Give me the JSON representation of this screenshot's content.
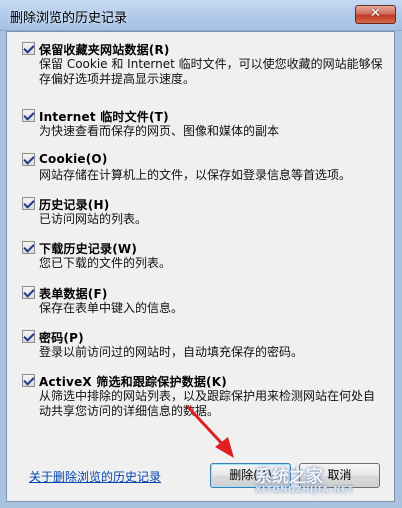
{
  "window": {
    "title": "删除浏览的历史记录",
    "close_label": "✕"
  },
  "options": [
    {
      "title": "保留收藏夹网站数据(R)",
      "desc": "保留 Cookie 和 Internet 临时文件，可以使您收藏的网站能够保存偏好选项并提高显示速度。",
      "checked": true
    },
    {
      "title": "Internet 临时文件(T)",
      "desc": "为快速查看而保存的网页、图像和媒体的副本",
      "checked": true
    },
    {
      "title": "Cookie(O)",
      "desc": "网站存储在计算机上的文件，以保存如登录信息等首选项。",
      "checked": true
    },
    {
      "title": "历史记录(H)",
      "desc": "已访问网站的列表。",
      "checked": true
    },
    {
      "title": "下载历史记录(W)",
      "desc": "您已下载的文件的列表。",
      "checked": true
    },
    {
      "title": "表单数据(F)",
      "desc": "保存在表单中键入的信息。",
      "checked": true
    },
    {
      "title": "密码(P)",
      "desc": "登录以前访问过的网站时，自动填充保存的密码。",
      "checked": true
    },
    {
      "title": "ActiveX 筛选和跟踪保护数据(K)",
      "desc": "从筛选中排除的网站列表，以及跟踪保护用来检测网站在何处自动共享您访问的详细信息的数据。",
      "checked": true
    }
  ],
  "footer": {
    "link": "关于删除浏览的历史记录",
    "delete_button": "删除(D)",
    "cancel_button": "取消"
  },
  "watermark": {
    "text": "系统之家",
    "sub": "XITONGZHIJIA.NET"
  },
  "colors": {
    "titlebar": "#b4cbea",
    "close": "#c7432d",
    "link": "#0645ad",
    "arrow": "#e02020"
  }
}
